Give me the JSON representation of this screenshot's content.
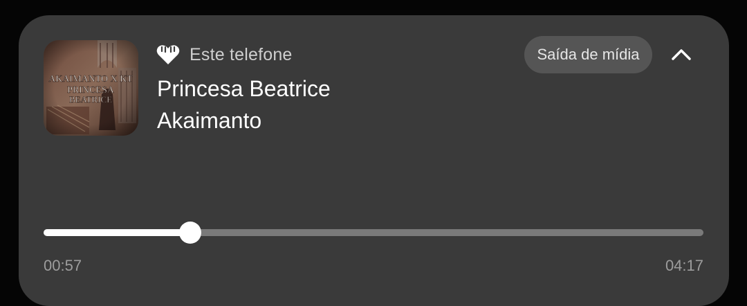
{
  "media": {
    "source_label": "Este telefone",
    "source_icon": "heart-icon",
    "title": "Princesa Beatrice",
    "artist": "Akaimanto",
    "album_art_text": "AKAIMANTO X KT PRINCESA BEATRICE",
    "output_button_label": "Saída de mídia",
    "collapse_icon": "chevron-up-icon"
  },
  "progress": {
    "elapsed": "00:57",
    "total": "04:17",
    "fraction": 0.2218
  },
  "colors": {
    "card_background": "#3a3a3a",
    "page_background": "#050505",
    "output_button": "#555555",
    "track_remaining": "#7a7a7a",
    "track_played": "#ffffff",
    "time_text": "#9d9d9d"
  }
}
